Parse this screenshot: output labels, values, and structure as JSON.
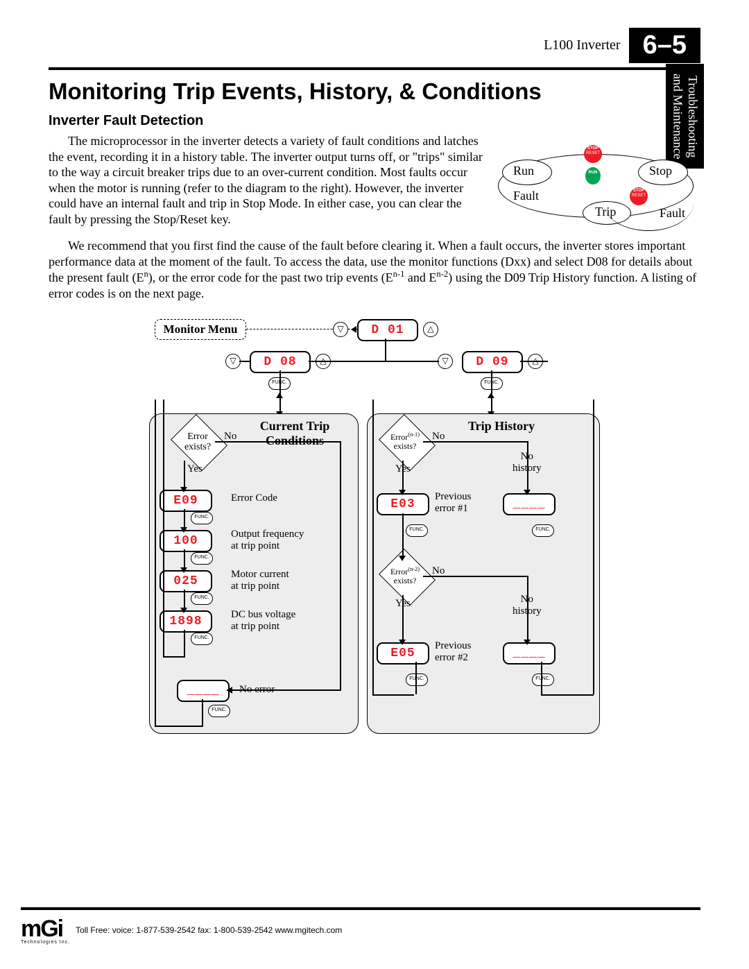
{
  "header": {
    "product": "L100 Inverter",
    "page_num": "6–5"
  },
  "side_tab": {
    "line1": "Troubleshooting",
    "line2": "and Maintenance"
  },
  "title": "Monitoring Trip Events, History, & Conditions",
  "section_title": "Inverter Fault Detection",
  "para1": "The microprocessor in the inverter detects a variety of fault conditions and latches the event, recording it in a history table. The inverter output turns off, or \"trips\" similar to the way a circuit breaker trips due to an over-current condition. Most faults occur when the motor is running (refer to the diagram to the right). However, the inverter could have an internal fault and trip in Stop Mode. In either case, you can clear the fault by pressing the Stop/Reset key.",
  "para2_pre": "We recommend that you first find the cause of the fault before clearing it. When a fault occurs, the inverter stores important performance data at the moment of the fault. To access the data, use the monitor functions (Dxx) and select D08 for details about the present fault (E",
  "para2_sup1": "n",
  "para2_mid1": "), or the error code for the past two trip events (E",
  "para2_sup2": "n-1",
  "para2_mid2": " and  E",
  "para2_sup3": "n-2",
  "para2_post": ") using the D09 Trip History function. A listing of error codes is on the next page.",
  "state_diagram": {
    "run": "Run",
    "stop": "Stop",
    "trip": "Trip",
    "fault_left": "Fault",
    "fault_right": "Fault",
    "btn_stop_reset": "STOP\nRESET",
    "btn_run": "RUN"
  },
  "flow": {
    "monitor_menu": "Monitor Menu",
    "d01": "D 01",
    "d08": "D 08",
    "d09": "D 09",
    "func": "FUNC.",
    "left": {
      "title1": "Current Trip",
      "title2": "Conditions",
      "error_exists": "Error\nexists?",
      "yes": "Yes",
      "no": "No",
      "e09": "E09",
      "v100": "100",
      "v025": "025",
      "v1898": "1898",
      "lab_err": "Error Code",
      "lab_freq": "Output frequency\nat trip point",
      "lab_curr": "Motor current\nat trip point",
      "lab_dc": "DC bus voltage\nat trip point",
      "lab_noerr": "No error",
      "blank": "____"
    },
    "right": {
      "title": "Trip History",
      "err_n1": "Error",
      "err_n1_sup": "(n-1)",
      "err_n2": "Error",
      "err_n2_sup": "(n-2)",
      "exists": "exists?",
      "yes": "Yes",
      "no": "No",
      "no_history": "No\nhistory",
      "e03": "E03",
      "e05": "E05",
      "prev1": "Previous\nerror #1",
      "prev2": "Previous\nerror #2",
      "blank": "____"
    }
  },
  "footer": {
    "logo_main": "mGi",
    "logo_sub": "Technologies Inc.",
    "contact": "Toll Free:   voice: 1-877-539-2542  fax: 1-800-539-2542   www.mgitech.com"
  }
}
